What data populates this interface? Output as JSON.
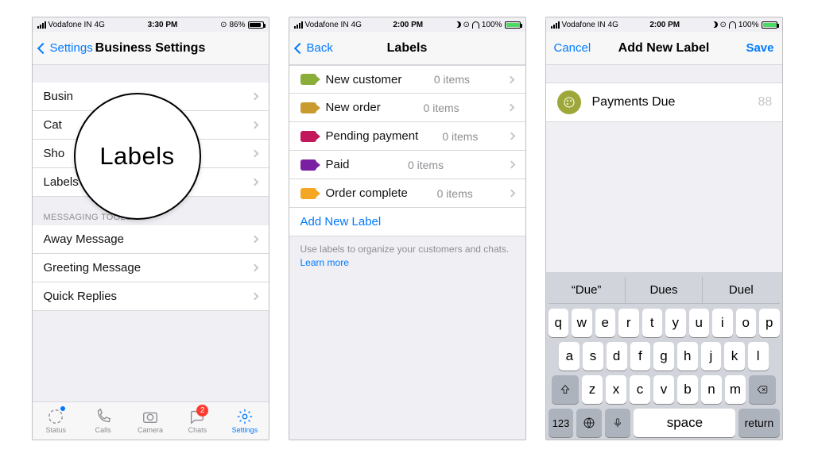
{
  "statusA": {
    "carrier": "Vodafone IN",
    "net": "4G",
    "time": "3:30 PM",
    "batt": "86%",
    "icons": [
      "alarm"
    ]
  },
  "statusB": {
    "carrier": "Vodafone IN",
    "net": "4G",
    "time": "2:00 PM",
    "batt": "100%",
    "icons": [
      "moon",
      "alarm",
      "headphones"
    ]
  },
  "statusC": {
    "carrier": "Vodafone IN",
    "net": "4G",
    "time": "2:00 PM",
    "batt": "100%",
    "icons": [
      "moon",
      "alarm",
      "headphones"
    ]
  },
  "screen1": {
    "back": "Settings",
    "title": "Business Settings",
    "group1": [
      "Business Profile",
      "Catalog",
      "Short Link",
      "Labels"
    ],
    "group1_visible": [
      "Busin",
      "Cat",
      "Sho",
      "Labels"
    ],
    "group2_header": "MESSAGING TOOLS",
    "group2": [
      "Away Message",
      "Greeting Message",
      "Quick Replies"
    ],
    "magnifier": "Labels",
    "tabs": [
      "Status",
      "Calls",
      "Camera",
      "Chats",
      "Settings"
    ],
    "chats_badge": "2"
  },
  "screen2": {
    "back": "Back",
    "title": "Labels",
    "labels": [
      {
        "name": "New customer",
        "count": "0 items",
        "color": "#8bae3b"
      },
      {
        "name": "New order",
        "count": "0 items",
        "color": "#c99a2e"
      },
      {
        "name": "Pending payment",
        "count": "0 items",
        "color": "#c2185b"
      },
      {
        "name": "Paid",
        "count": "0 items",
        "color": "#7b1fa2"
      },
      {
        "name": "Order complete",
        "count": "0 items",
        "color": "#f5a623"
      }
    ],
    "add": "Add New Label",
    "hint": "Use labels to organize your customers and chats. ",
    "learn": "Learn more"
  },
  "screen3": {
    "cancel": "Cancel",
    "title": "Add New Label",
    "save": "Save",
    "value": "Payments Due",
    "count": "88",
    "color": "#9ea83a",
    "suggestions": [
      "“Due”",
      "Dues",
      "Duel"
    ],
    "rows": [
      [
        "q",
        "w",
        "e",
        "r",
        "t",
        "y",
        "u",
        "i",
        "o",
        "p"
      ],
      [
        "a",
        "s",
        "d",
        "f",
        "g",
        "h",
        "j",
        "k",
        "l"
      ],
      [
        "z",
        "x",
        "c",
        "v",
        "b",
        "n",
        "m"
      ]
    ],
    "numKey": "123",
    "space": "space",
    "return": "return"
  }
}
